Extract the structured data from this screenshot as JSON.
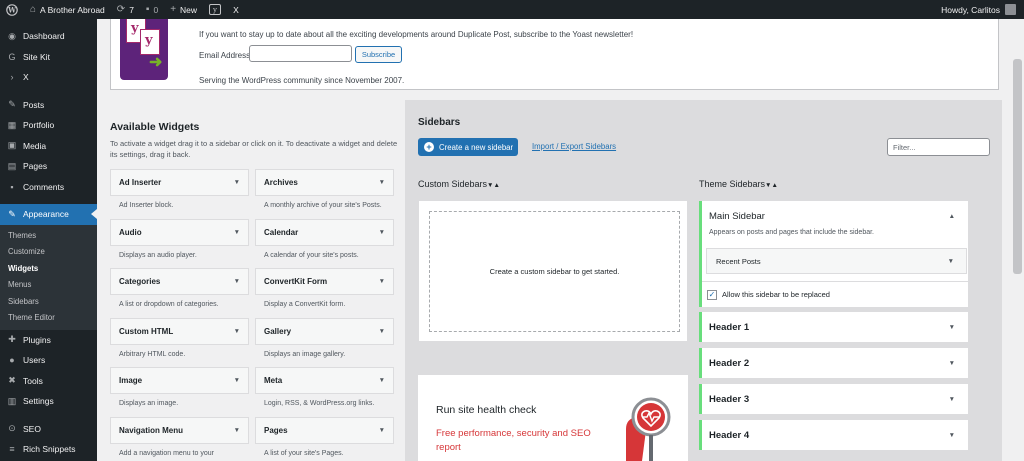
{
  "admin_bar": {
    "site_name": "A Brother Abroad",
    "updates_count": "7",
    "comments_count": "0",
    "new_label": "New",
    "x_label": "X",
    "howdy": "Howdy, Carlitos"
  },
  "menu": {
    "items_top": [
      {
        "label": "Dashboard",
        "icon": "dashboard-icon"
      },
      {
        "label": "Site Kit",
        "icon": "sitekit-icon"
      },
      {
        "label": "X",
        "icon": "x-icon"
      }
    ],
    "items_mid": [
      {
        "label": "Posts",
        "icon": "pin-icon"
      },
      {
        "label": "Portfolio",
        "icon": "portfolio-icon"
      },
      {
        "label": "Media",
        "icon": "media-icon"
      },
      {
        "label": "Pages",
        "icon": "pages-icon"
      },
      {
        "label": "Comments",
        "icon": "comments-icon"
      }
    ],
    "current": {
      "label": "Appearance",
      "icon": "appearance-icon"
    },
    "submenu": [
      "Themes",
      "Customize",
      "Widgets",
      "Menus",
      "Sidebars",
      "Theme Editor"
    ],
    "current_sub": "Widgets",
    "items_after": [
      {
        "label": "Plugins",
        "icon": "plugins-icon"
      },
      {
        "label": "Users",
        "icon": "users-icon"
      },
      {
        "label": "Tools",
        "icon": "tools-icon"
      },
      {
        "label": "Settings",
        "icon": "settings-icon"
      }
    ],
    "items_bottom": [
      {
        "label": "SEO",
        "icon": "seo-icon"
      },
      {
        "label": "Rich Snippets",
        "icon": "rich-snippets-icon"
      }
    ]
  },
  "notice": {
    "text": "If you want to stay up to date about all the exciting developments around Duplicate Post, subscribe to the Yoast newsletter!",
    "email_label": "Email Address",
    "email_value": "",
    "subscribe_label": "Subscribe",
    "footer": "Serving the WordPress community since November 2007."
  },
  "available": {
    "title": "Available Widgets",
    "desc": "To activate a widget drag it to a sidebar or click on it. To deactivate a widget and delete its settings, drag it back.",
    "widgets": [
      {
        "name": "Ad Inserter",
        "desc": "Ad Inserter block."
      },
      {
        "name": "Archives",
        "desc": "A monthly archive of your site's Posts."
      },
      {
        "name": "Audio",
        "desc": "Displays an audio player."
      },
      {
        "name": "Calendar",
        "desc": "A calendar of your site's posts."
      },
      {
        "name": "Categories",
        "desc": "A list or dropdown of categories."
      },
      {
        "name": "ConvertKit Form",
        "desc": "Display a ConvertKit form."
      },
      {
        "name": "Custom HTML",
        "desc": "Arbitrary HTML code."
      },
      {
        "name": "Gallery",
        "desc": "Displays an image gallery."
      },
      {
        "name": "Image",
        "desc": "Displays an image."
      },
      {
        "name": "Meta",
        "desc": "Login, RSS, & WordPress.org links."
      },
      {
        "name": "Navigation Menu",
        "desc": "Add a navigation menu to your"
      },
      {
        "name": "Pages",
        "desc": "A list of your site's Pages."
      }
    ]
  },
  "sidebars": {
    "title": "Sidebars",
    "create_label": "Create a new sidebar",
    "import_export_label": "Import / Export Sidebars",
    "filter_placeholder": "Filter...",
    "custom_heading": "Custom Sidebars",
    "theme_heading": "Theme Sidebars",
    "custom_empty": "Create a custom sidebar to get started.",
    "main_sidebar": {
      "title": "Main Sidebar",
      "desc": "Appears on posts and pages that include the sidebar.",
      "widget": "Recent Posts",
      "allow_label": "Allow this sidebar to be replaced",
      "allow_checked": true
    },
    "headers": [
      "Header 1",
      "Header 2",
      "Header 3",
      "Header 4"
    ]
  },
  "health": {
    "title": "Run site health check",
    "link": "Free performance, security and SEO report"
  }
}
